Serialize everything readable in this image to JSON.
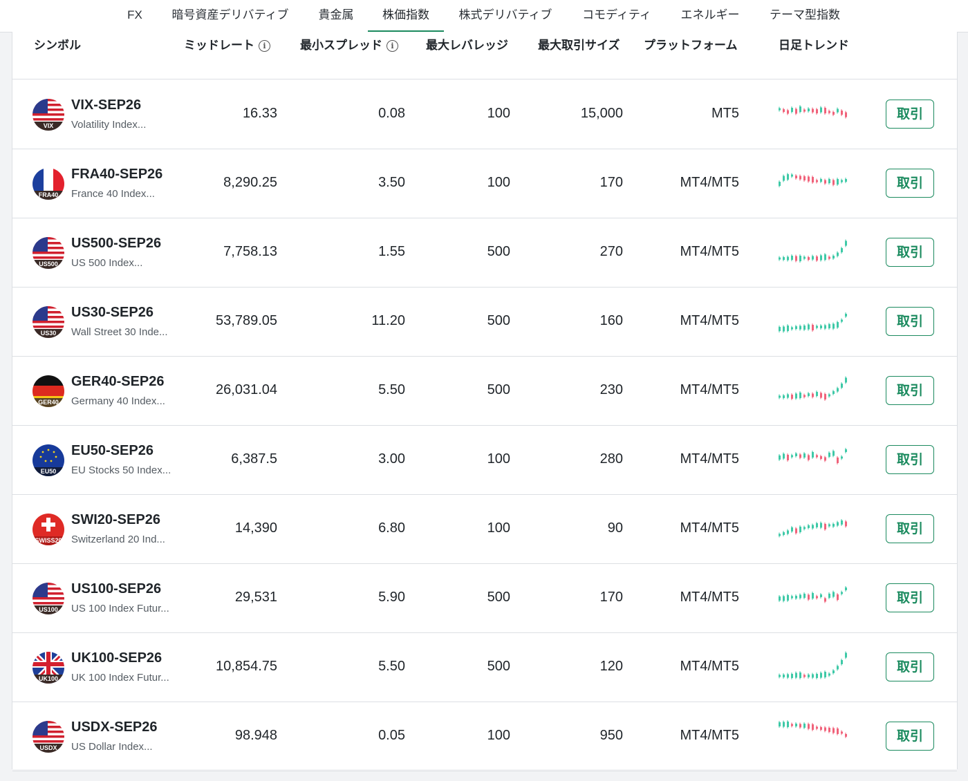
{
  "tabs": [
    {
      "label": "FX"
    },
    {
      "label": "暗号資産デリバティブ"
    },
    {
      "label": "貴金属"
    },
    {
      "label": "株価指数"
    },
    {
      "label": "株式デリバティブ"
    },
    {
      "label": "コモディティ"
    },
    {
      "label": "エネルギー"
    },
    {
      "label": "テーマ型指数"
    }
  ],
  "active_tab": "株価指数",
  "columns": {
    "symbol": "シンボル",
    "mid_rate": "ミッドレート",
    "min_spread": "最小スプレッド",
    "max_leverage": "最大レバレッジ",
    "max_trade_size": "最大取引サイズ",
    "platform": "プラットフォーム",
    "daily_trend": "日足トレンド"
  },
  "info_glyph": "i",
  "trade_label": "取引",
  "colors": {
    "accent": "#1a8a5e",
    "up": "#3ec9a7",
    "down": "#f0627a"
  },
  "rows": [
    {
      "flag_label": "VIX",
      "flag": "us",
      "symbol": "VIX-SEP26",
      "desc": "Volatility Index...",
      "mid": "16.33",
      "spread": "0.08",
      "leverage": "100",
      "size": "15,000",
      "platform": "MT5"
    },
    {
      "flag_label": "FRA40",
      "flag": "fr",
      "symbol": "FRA40-SEP26",
      "desc": "France 40 Index...",
      "mid": "8,290.25",
      "spread": "3.50",
      "leverage": "100",
      "size": "170",
      "platform": "MT4/MT5"
    },
    {
      "flag_label": "US500",
      "flag": "us",
      "symbol": "US500-SEP26",
      "desc": "US 500 Index...",
      "mid": "7,758.13",
      "spread": "1.55",
      "leverage": "500",
      "size": "270",
      "platform": "MT4/MT5"
    },
    {
      "flag_label": "US30",
      "flag": "us",
      "symbol": "US30-SEP26",
      "desc": "Wall Street 30 Inde...",
      "mid": "53,789.05",
      "spread": "11.20",
      "leverage": "500",
      "size": "160",
      "platform": "MT4/MT5"
    },
    {
      "flag_label": "GER40",
      "flag": "de",
      "symbol": "GER40-SEP26",
      "desc": "Germany 40 Index...",
      "mid": "26,031.04",
      "spread": "5.50",
      "leverage": "500",
      "size": "230",
      "platform": "MT4/MT5"
    },
    {
      "flag_label": "EU50",
      "flag": "eu",
      "symbol": "EU50-SEP26",
      "desc": "EU Stocks 50 Index...",
      "mid": "6,387.5",
      "spread": "3.00",
      "leverage": "100",
      "size": "280",
      "platform": "MT4/MT5"
    },
    {
      "flag_label": "SWISS20",
      "flag": "ch",
      "symbol": "SWI20-SEP26",
      "desc": "Switzerland 20 Ind...",
      "mid": "14,390",
      "spread": "6.80",
      "leverage": "100",
      "size": "90",
      "platform": "MT4/MT5"
    },
    {
      "flag_label": "US100",
      "flag": "us",
      "symbol": "US100-SEP26",
      "desc": "US 100 Index Futur...",
      "mid": "29,531",
      "spread": "5.90",
      "leverage": "500",
      "size": "170",
      "platform": "MT4/MT5"
    },
    {
      "flag_label": "UK100",
      "flag": "uk",
      "symbol": "UK100-SEP26",
      "desc": "UK 100 Index Futur...",
      "mid": "10,854.75",
      "spread": "5.50",
      "leverage": "500",
      "size": "120",
      "platform": "MT4/MT5"
    },
    {
      "flag_label": "USDX",
      "flag": "us",
      "symbol": "USDX-SEP26",
      "desc": "US Dollar Index...",
      "mid": "98.948",
      "spread": "0.05",
      "leverage": "100",
      "size": "950",
      "platform": "MT4/MT5"
    }
  ]
}
